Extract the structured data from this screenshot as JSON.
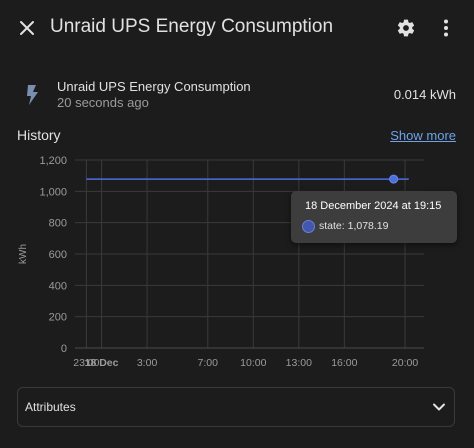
{
  "dialog": {
    "title": "Unraid UPS Energy Consumption"
  },
  "entity": {
    "name": "Unraid UPS Energy Consumption",
    "last_changed": "20 seconds ago",
    "value": "0.014 kWh",
    "icon": "lightning-bolt-icon"
  },
  "history": {
    "title": "History",
    "show_more": "Show more"
  },
  "chart_data": {
    "type": "line",
    "xlabel": "",
    "ylabel": "kWh",
    "ylim": [
      0,
      1200
    ],
    "y_ticks": [
      "0",
      "200",
      "400",
      "600",
      "800",
      "1,000",
      "1,200"
    ],
    "x_ticks": [
      "23:00",
      "18 Dec",
      "3:00",
      "7:00",
      "10:00",
      "13:00",
      "16:00",
      "20:00"
    ],
    "grid": true,
    "legend": "none",
    "series": [
      {
        "color": "#4a6ee0",
        "x": [
          "2024-12-17 23:00",
          "2024-12-18 19:15",
          "2024-12-18 20:15"
        ],
        "y": [
          1078.19,
          1078.19,
          1078.19
        ]
      }
    ],
    "highlight": {
      "x": "2024-12-18 19:15",
      "y": 1078.19
    }
  },
  "tooltip": {
    "title": "18 December 2024 at 19:15",
    "line": "state: 1,078.19"
  },
  "attributes": {
    "label": "Attributes"
  },
  "colors": {
    "background": "#1c1c1c",
    "accent": "#6ea3e8",
    "series": "#4a6ee0"
  }
}
